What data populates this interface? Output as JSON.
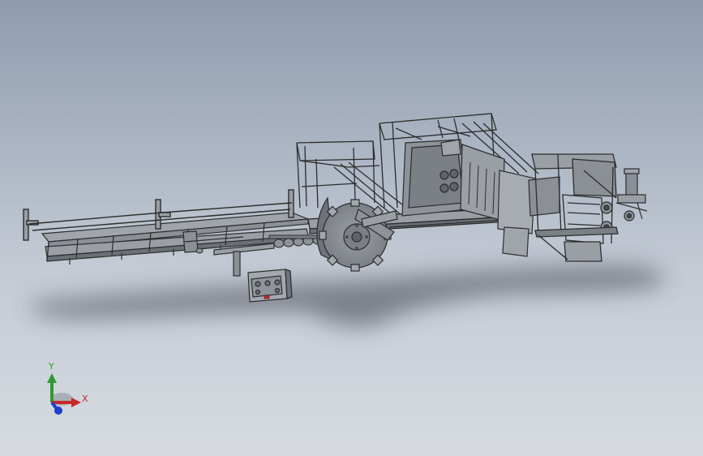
{
  "viewport": {
    "background_top": "#8f9cb0",
    "background_bottom": "#d7dbe1",
    "render_mode": "shaded-with-edges"
  },
  "model": {
    "assemblies": [
      "infeed-conveyor",
      "support-rails",
      "roller-row",
      "control-panel",
      "main-frame",
      "saw-blade",
      "cabinet",
      "outfeed-frame",
      "motor"
    ],
    "colors": {
      "edge": "#2d2d2d",
      "face_light": "#a0a4ab",
      "face_mid": "#8b8f96",
      "face_dark": "#6b6f76",
      "shadow": "#4a4d55",
      "indicator": "#d32020"
    }
  },
  "triad": {
    "x_label": "X",
    "y_label": "Y",
    "x_color": "#c62828",
    "y_color": "#2f9a2f",
    "z_color": "#1f3fc9",
    "origin_color": "#8a8f98"
  }
}
